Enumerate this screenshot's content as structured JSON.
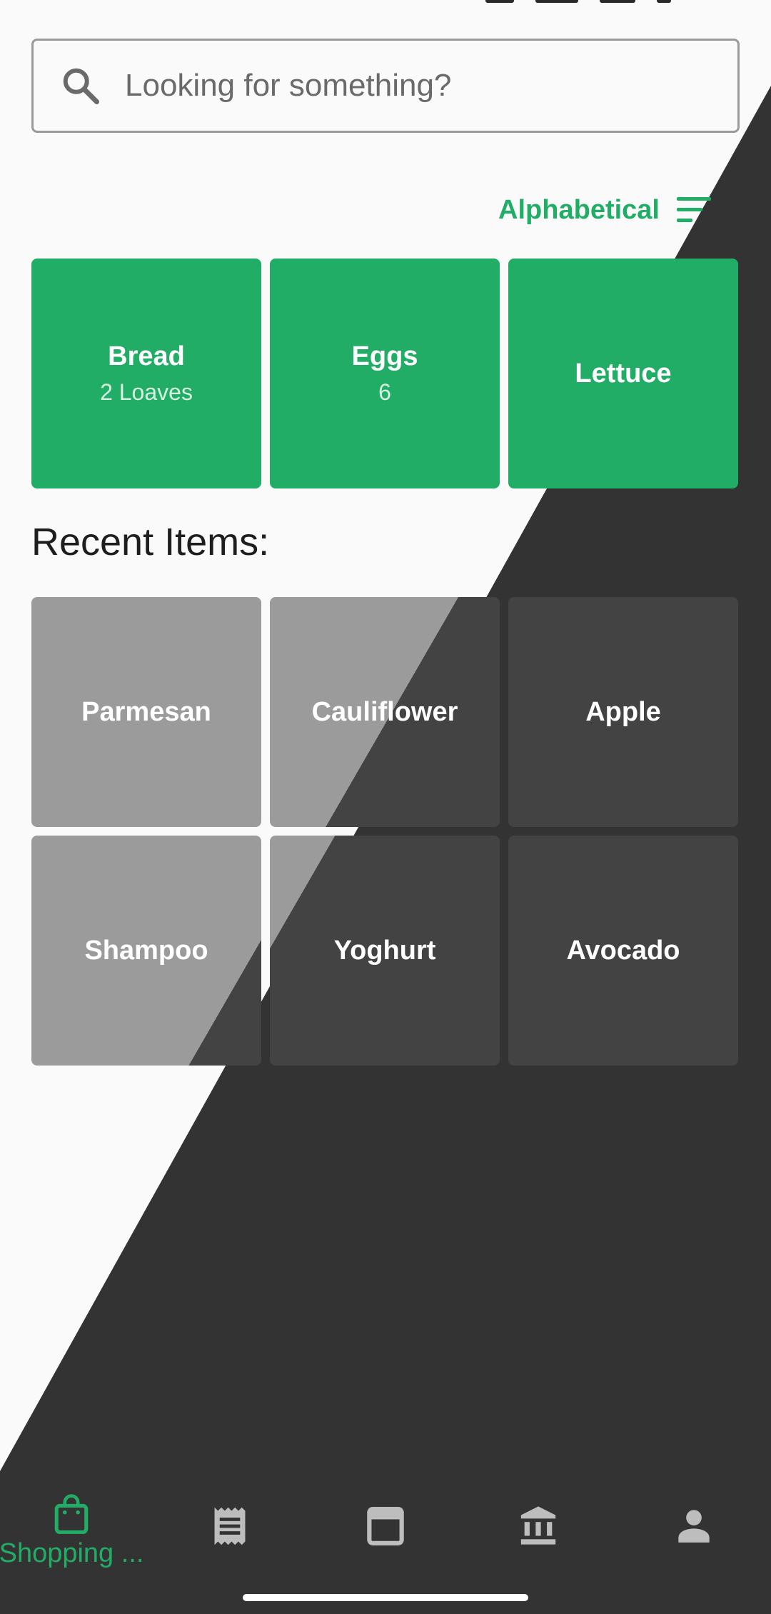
{
  "search": {
    "placeholder": "Looking for something?"
  },
  "sort": {
    "label": "Alphabetical"
  },
  "shopping_list": [
    {
      "name": "Bread",
      "quantity": "2 Loaves"
    },
    {
      "name": "Eggs",
      "quantity": "6"
    },
    {
      "name": "Lettuce",
      "quantity": ""
    }
  ],
  "recent": {
    "title": "Recent Items:",
    "items": [
      "Parmesan",
      "Cauliflower",
      "Apple",
      "Shampoo",
      "Yoghurt",
      "Avocado"
    ]
  },
  "nav": {
    "items": [
      {
        "label": "Shopping ...",
        "icon": "shopping-bag-icon",
        "active": true
      },
      {
        "label": "",
        "icon": "receipt-icon",
        "active": false
      },
      {
        "label": "",
        "icon": "calendar-icon",
        "active": false
      },
      {
        "label": "",
        "icon": "bank-icon",
        "active": false
      },
      {
        "label": "",
        "icon": "person-icon",
        "active": false
      }
    ]
  },
  "colors": {
    "accent": "#22ad67",
    "dark_background": "#333333",
    "light_background": "#fafafa",
    "recent_tile_light": "#9b9b9b",
    "recent_tile_dark": "#434343",
    "nav_icon_inactive": "#bdbdbd"
  }
}
